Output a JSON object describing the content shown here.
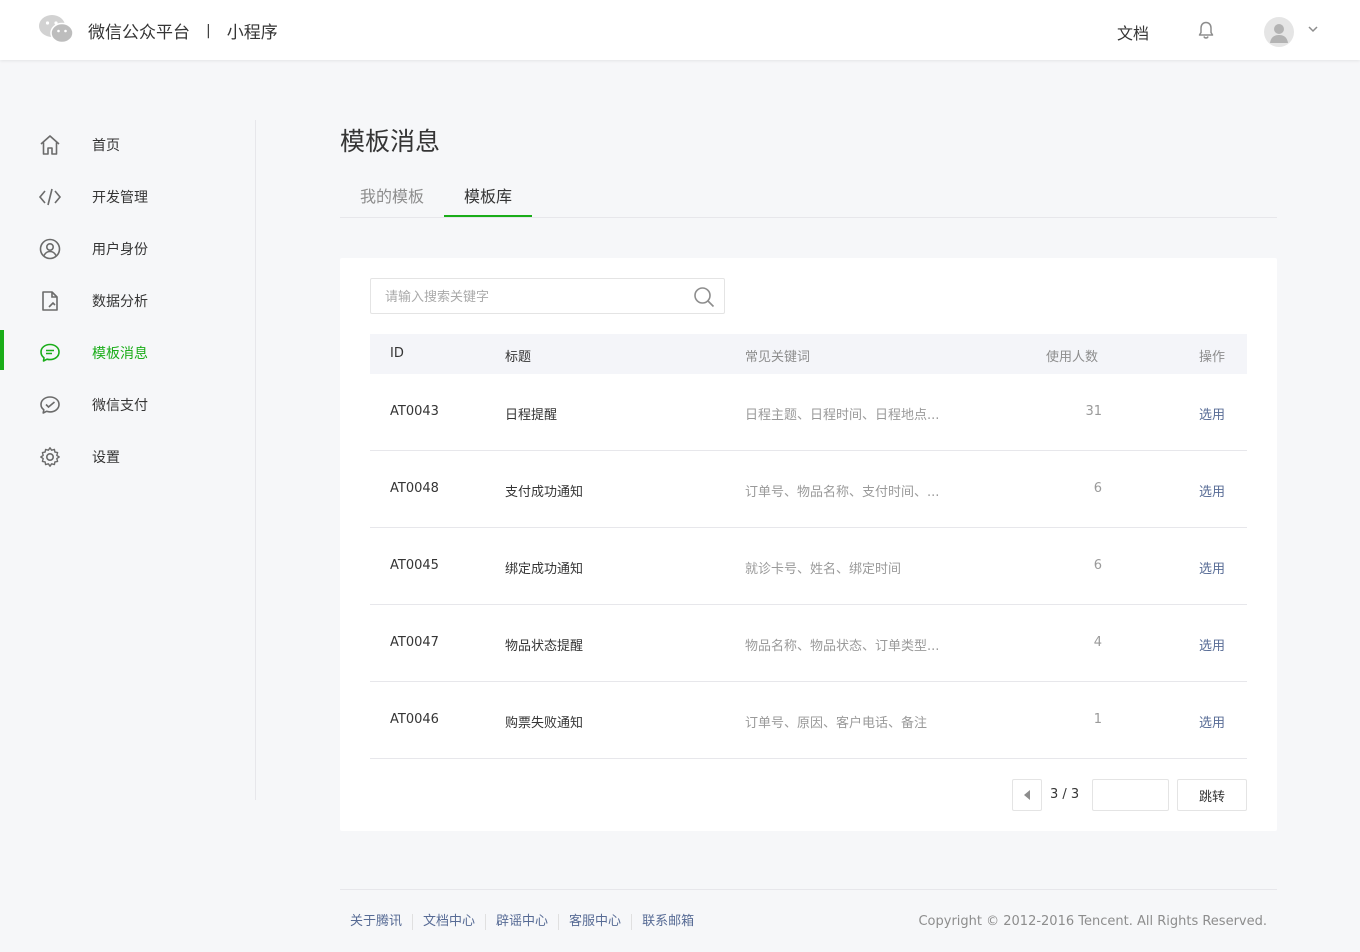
{
  "header": {
    "brand": "微信公众平台",
    "separator": "|",
    "product": "小程序",
    "doc_link": "文档"
  },
  "sidebar": {
    "items": [
      {
        "label": "首页",
        "icon": "home-icon"
      },
      {
        "label": "开发管理",
        "icon": "code-icon"
      },
      {
        "label": "用户身份",
        "icon": "user-circle-icon"
      },
      {
        "label": "数据分析",
        "icon": "document-chart-icon"
      },
      {
        "label": "模板消息",
        "icon": "message-icon",
        "active": true
      },
      {
        "label": "微信支付",
        "icon": "wechat-pay-icon"
      },
      {
        "label": "设置",
        "icon": "gear-icon"
      }
    ]
  },
  "main": {
    "title": "模板消息",
    "tabs": [
      {
        "label": "我的模板"
      },
      {
        "label": "模板库",
        "active": true
      }
    ],
    "search": {
      "placeholder": "请输入搜索关键字",
      "value": ""
    },
    "table": {
      "columns": {
        "id": "ID",
        "title": "标题",
        "keywords": "常见关键词",
        "count": "使用人数",
        "action": "操作"
      },
      "rows": [
        {
          "id": "AT0043",
          "title": "日程提醒",
          "keywords": "日程主题、日程时间、日程地点...",
          "count": "31",
          "action": "选用"
        },
        {
          "id": "AT0048",
          "title": "支付成功通知",
          "keywords": "订单号、物品名称、支付时间、...",
          "count": "6",
          "action": "选用"
        },
        {
          "id": "AT0045",
          "title": "绑定成功通知",
          "keywords": "就诊卡号、姓名、绑定时间",
          "count": "6",
          "action": "选用"
        },
        {
          "id": "AT0047",
          "title": "物品状态提醒",
          "keywords": "物品名称、物品状态、订单类型...",
          "count": "4",
          "action": "选用"
        },
        {
          "id": "AT0046",
          "title": "购票失败通知",
          "keywords": "订单号、原因、客户电话、备注",
          "count": "1",
          "action": "选用"
        }
      ]
    },
    "pagination": {
      "info": "3 / 3",
      "jump_value": "",
      "go_label": "跳转"
    }
  },
  "footer": {
    "links": [
      "关于腾讯",
      "文档中心",
      "辟谣中心",
      "客服中心",
      "联系邮箱"
    ],
    "copyright": "Copyright © 2012-2016 Tencent. All Rights Reserved."
  },
  "colors": {
    "accent": "#1aad19",
    "link": "#576b95"
  }
}
